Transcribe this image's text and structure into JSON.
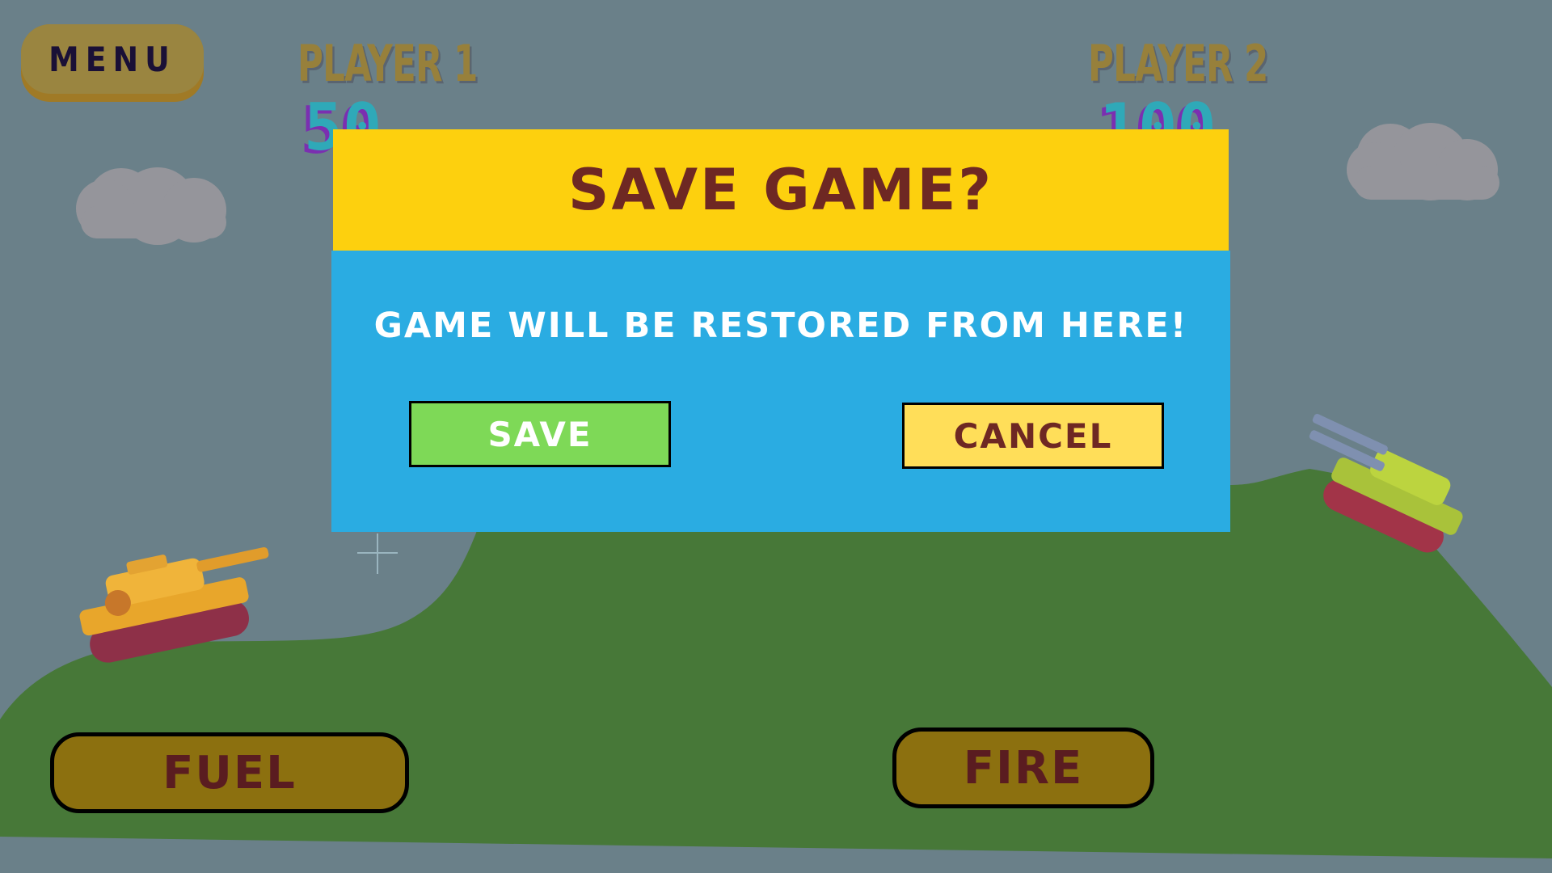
{
  "menu": {
    "label": "MENU"
  },
  "players": [
    {
      "label": "PLAYER 1",
      "score": "50"
    },
    {
      "label": "PLAYER 2",
      "score": "100"
    }
  ],
  "dialog": {
    "title": "SAVE GAME?",
    "message": "GAME WILL BE RESTORED FROM HERE!",
    "save_label": "SAVE",
    "cancel_label": "CANCEL"
  },
  "controls": {
    "fuel_label": "FUEL",
    "fire_label": "FIRE"
  },
  "colors": {
    "sky": "#6a8089",
    "hill": "#477838",
    "dialog_header": "#fdd00e",
    "dialog_body": "#2aace2",
    "save_button": "#7ed957",
    "cancel_button": "#ffde59",
    "control_button": "#8c700f"
  }
}
